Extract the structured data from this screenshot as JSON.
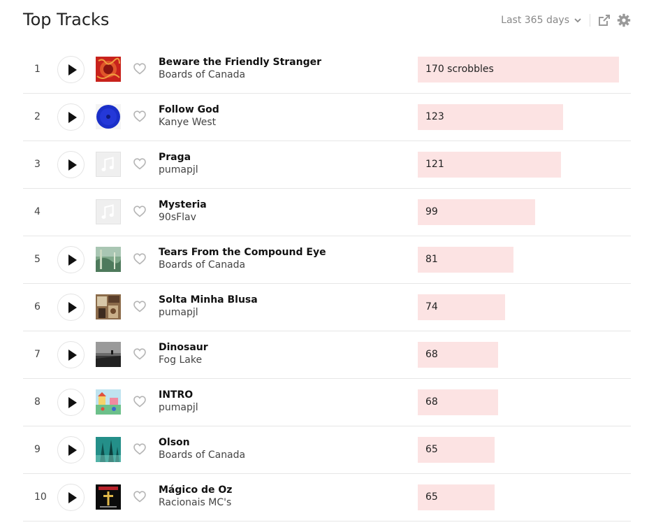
{
  "header": {
    "title": "Top Tracks",
    "period_label": "Last 365 days",
    "icons": [
      "chevron-down-icon",
      "share-icon",
      "gear-icon"
    ]
  },
  "colors": {
    "bar": "#fce3e3",
    "text": "#222222",
    "muted": "#888888"
  },
  "max_scrobbles": 170,
  "tracks": [
    {
      "rank": "1",
      "title": "Beware the Friendly Stranger",
      "artist": "Boards of Canada",
      "scrobbles": 170,
      "label": "170 scrobbles",
      "art": "red-abstract-art",
      "playable": true
    },
    {
      "rank": "2",
      "title": "Follow God",
      "artist": "Kanye West",
      "scrobbles": 123,
      "label": "123",
      "art": "blue-disc-art",
      "playable": true
    },
    {
      "rank": "3",
      "title": "Praga",
      "artist": "pumapjl",
      "scrobbles": 121,
      "label": "121",
      "art": "placeholder-music-note",
      "playable": true
    },
    {
      "rank": "4",
      "title": "Mysteria",
      "artist": "90sFlav",
      "scrobbles": 99,
      "label": "99",
      "art": "placeholder-music-note",
      "playable": false
    },
    {
      "rank": "5",
      "title": "Tears From the Compound Eye",
      "artist": "Boards of Canada",
      "scrobbles": 81,
      "label": "81",
      "art": "green-landscape-art",
      "playable": true
    },
    {
      "rank": "6",
      "title": "Solta Minha Blusa",
      "artist": "pumapjl",
      "scrobbles": 74,
      "label": "74",
      "art": "brown-collage-art",
      "playable": true
    },
    {
      "rank": "7",
      "title": "Dinosaur",
      "artist": "Fog Lake",
      "scrobbles": 68,
      "label": "68",
      "art": "grey-sea-photo-art",
      "playable": true
    },
    {
      "rank": "8",
      "title": "INTRO",
      "artist": "pumapjl",
      "scrobbles": 68,
      "label": "68",
      "art": "colorful-cartoon-art",
      "playable": true
    },
    {
      "rank": "9",
      "title": "Olson",
      "artist": "Boards of Canada",
      "scrobbles": 65,
      "label": "65",
      "art": "teal-forest-art",
      "playable": true
    },
    {
      "rank": "10",
      "title": "Mágico de Oz",
      "artist": "Racionais MC's",
      "scrobbles": 65,
      "label": "65",
      "art": "black-cross-art",
      "playable": true
    }
  ]
}
